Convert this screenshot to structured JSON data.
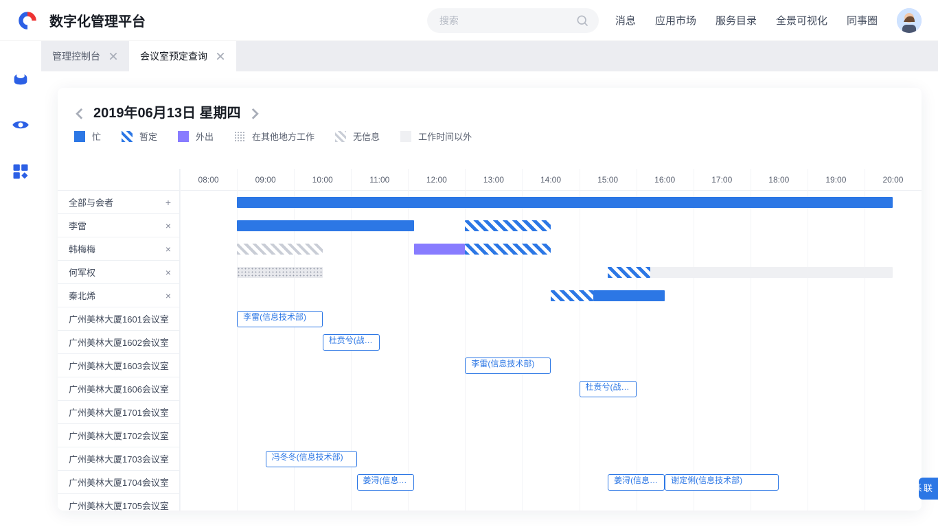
{
  "brand": "数字化管理平台",
  "search": {
    "placeholder": "搜索"
  },
  "nav": [
    "消息",
    "应用市场",
    "服务目录",
    "全景可视化",
    "同事圈"
  ],
  "tabs": [
    {
      "label": "管理控制台",
      "active": false
    },
    {
      "label": "会议室预定查询",
      "active": true
    }
  ],
  "date_label": "2019年06月13日  星期四",
  "legend": [
    {
      "cls": "sw-busy",
      "label": "忙"
    },
    {
      "cls": "sw-tent",
      "label": "暂定"
    },
    {
      "cls": "sw-out",
      "label": "外出"
    },
    {
      "cls": "sw-else",
      "label": "在其他地方工作"
    },
    {
      "cls": "sw-noinfo",
      "label": "无信息"
    },
    {
      "cls": "sw-off",
      "label": "工作时间以外"
    }
  ],
  "time_start": 8,
  "time_end": 20,
  "time_headers": [
    "08:00",
    "09:00",
    "10:00",
    "11:00",
    "12:00",
    "13:00",
    "14:00",
    "15:00",
    "16:00",
    "17:00",
    "18:00",
    "19:00",
    "20:00"
  ],
  "rows": [
    {
      "name": "全部与会者",
      "action": "+",
      "bars": [
        {
          "type": "b-busy",
          "from": 8.5,
          "to": 20
        }
      ]
    },
    {
      "name": "李雷",
      "action": "×",
      "bars": [
        {
          "type": "b-busy",
          "from": 8.5,
          "to": 11.6
        },
        {
          "type": "b-tent",
          "from": 12.5,
          "to": 14
        }
      ]
    },
    {
      "name": "韩梅梅",
      "action": "×",
      "bars": [
        {
          "type": "b-noinfo",
          "from": 8.5,
          "to": 10
        },
        {
          "type": "b-out",
          "from": 11.6,
          "to": 12.5
        },
        {
          "type": "b-tent",
          "from": 12.5,
          "to": 14
        }
      ]
    },
    {
      "name": "何军权",
      "action": "×",
      "bars": [
        {
          "type": "b-else",
          "from": 8.5,
          "to": 10
        },
        {
          "type": "b-tent",
          "from": 15,
          "to": 15.75
        },
        {
          "type": "b-off",
          "from": 15.75,
          "to": 20
        }
      ]
    },
    {
      "name": "秦北烯",
      "action": "×",
      "bars": [
        {
          "type": "b-tent",
          "from": 14,
          "to": 14.75
        },
        {
          "type": "b-busy",
          "from": 14.75,
          "to": 16
        }
      ]
    },
    {
      "name": "广州美林大厦1601会议室",
      "bars": [
        {
          "bordered": true,
          "text": "李雷(信息技术部)",
          "from": 8.5,
          "to": 10
        }
      ]
    },
    {
      "name": "广州美林大厦1602会议室",
      "bars": [
        {
          "bordered": true,
          "text": "杜贲兮(战…",
          "from": 10,
          "to": 11
        }
      ]
    },
    {
      "name": "广州美林大厦1603会议室",
      "bars": [
        {
          "bordered": true,
          "text": "李雷(信息技术部)",
          "from": 12.5,
          "to": 14
        }
      ]
    },
    {
      "name": "广州美林大厦1606会议室",
      "bars": [
        {
          "bordered": true,
          "text": "杜贲兮(战…",
          "from": 14.5,
          "to": 15.5
        }
      ]
    },
    {
      "name": "广州美林大厦1701会议室",
      "bars": []
    },
    {
      "name": "广州美林大厦1702会议室",
      "bars": []
    },
    {
      "name": "广州美林大厦1703会议室",
      "bars": [
        {
          "bordered": true,
          "text": "冯冬冬(信息技术部)",
          "from": 9.0,
          "to": 10.6
        }
      ]
    },
    {
      "name": "广州美林大厦1704会议室",
      "bars": [
        {
          "bordered": true,
          "text": "姜浔(信息…",
          "from": 10.6,
          "to": 11.6
        },
        {
          "bordered": true,
          "text": "姜浔(信息…",
          "from": 15,
          "to": 16
        },
        {
          "bordered": true,
          "text": "谢定俐(信息技术部)",
          "from": 16,
          "to": 18
        }
      ]
    },
    {
      "name": "广州美林大厦1705会议室",
      "bars": []
    }
  ],
  "contact_label": "联系我们"
}
